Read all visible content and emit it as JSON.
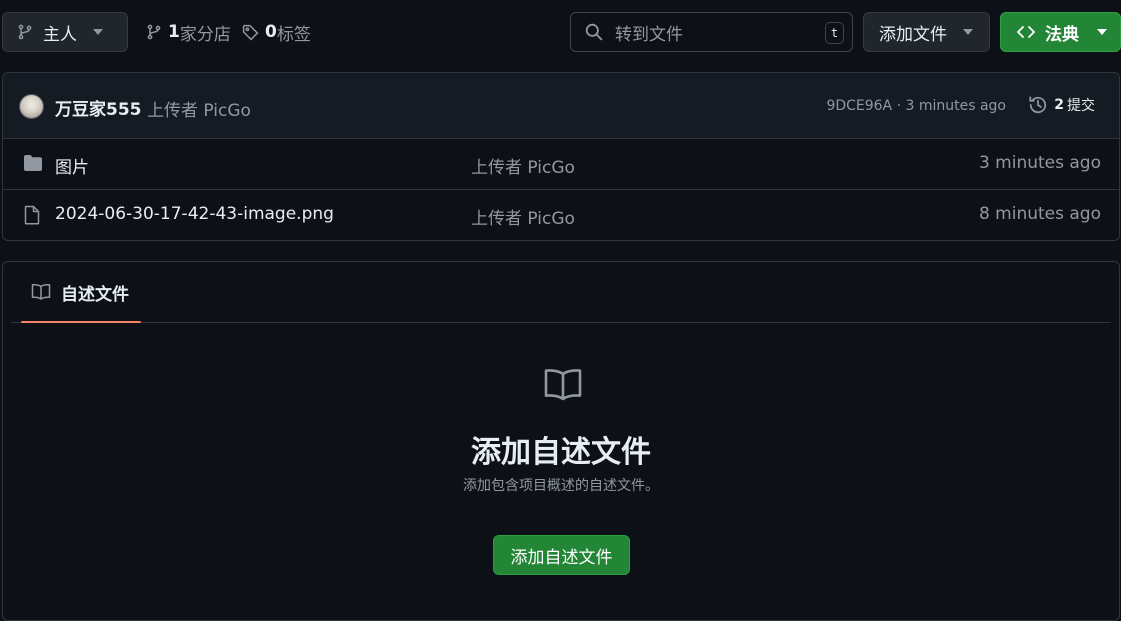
{
  "toolbar": {
    "branch_label": "主人",
    "branches_count": "1",
    "branches_label": "家分店",
    "tags_count": "0",
    "tags_label": " 标签",
    "search_placeholder": "转到文件",
    "search_shortcut": "t",
    "add_file_label": "添加文件",
    "code_label": "法典"
  },
  "commit": {
    "author": "万豆家555",
    "message": "上传者 PicGo",
    "meta": "9DCE96A · 3 minutes ago",
    "commits_count": "2",
    "commits_label": "提交"
  },
  "files": [
    {
      "type": "folder",
      "name": "图片",
      "message": "上传者 PicGo",
      "date": "3 minutes ago"
    },
    {
      "type": "file",
      "name": "2024-06-30-17-42-43-image.png",
      "message": "上传者 PicGo",
      "date": "8 minutes ago"
    }
  ],
  "readme": {
    "tab_label": "自述文件",
    "empty_title": "添加自述文件",
    "empty_desc": "添加包含项目概述的自述文件。",
    "button_label": "添加自述文件"
  },
  "icons": {
    "branch": "git-branch-icon",
    "tag": "tag-icon",
    "search": "search-icon",
    "caret": "triangle-down-icon",
    "code": "code-icon",
    "history": "history-icon",
    "folder": "folder-icon",
    "file": "file-icon",
    "book": "book-icon"
  },
  "colors": {
    "background": "#0d1117",
    "panel": "#151b23",
    "border": "#30363d",
    "primary_green": "#238636",
    "tab_underline": "#f78166",
    "muted_text": "#9198a1"
  }
}
